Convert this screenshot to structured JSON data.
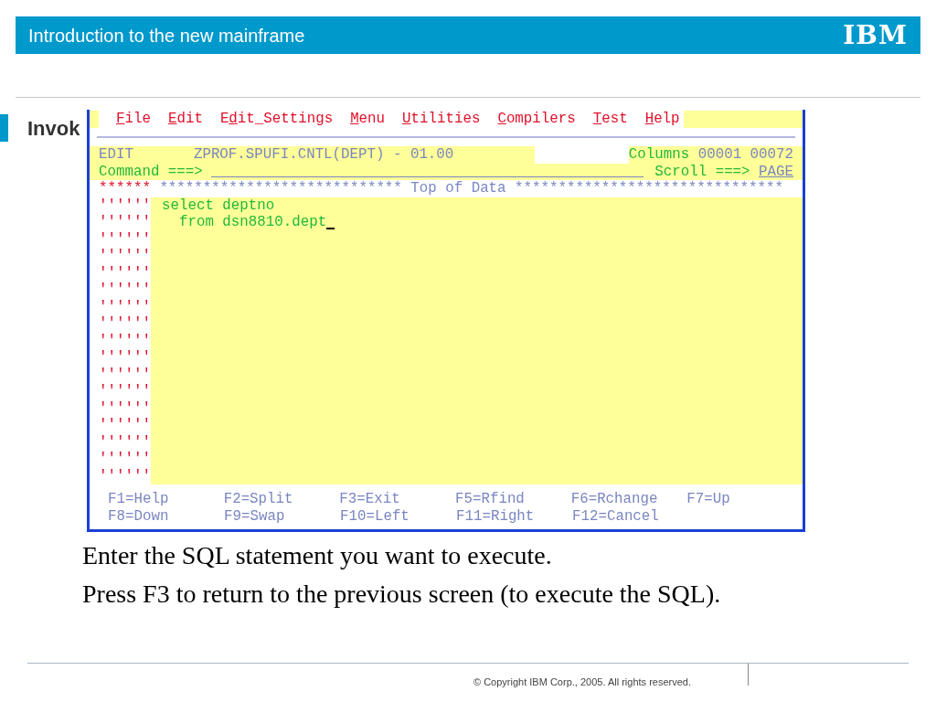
{
  "header": {
    "title": "Introduction to the new mainframe",
    "logo": "IBM"
  },
  "slide_title": "Invok",
  "terminal": {
    "menu": [
      {
        "key": "F",
        "after": "ile"
      },
      {
        "key": "E",
        "after": "dit"
      },
      {
        "before": "E",
        "key": "d",
        "after": "it_Settings"
      },
      {
        "key": "M",
        "after": "enu"
      },
      {
        "key": "U",
        "after": "tilities"
      },
      {
        "key": "C",
        "after": "ompilers"
      },
      {
        "key": "T",
        "after": "est"
      },
      {
        "key": "H",
        "after": "elp"
      }
    ],
    "edit_line": {
      "mode": "EDIT",
      "dataset": "ZPROF.SPUFI.CNTL(DEPT) - 01.00",
      "columns_label": "Columns",
      "columns_value": "00001 00072"
    },
    "command_line": {
      "label": "Command ===>",
      "scroll_label": "Scroll ===>",
      "scroll_value": "PAGE"
    },
    "top_of_data": {
      "prefix": "******",
      "text": "**************************** Top of Data *******************************"
    },
    "lines": [
      {
        "prefix": "''''''",
        "text": "select deptno",
        "cursor": false
      },
      {
        "prefix": "''''''",
        "text": "  from dsn8810.dept",
        "cursor": true
      },
      {
        "prefix": "''''''",
        "cursor": false
      },
      {
        "prefix": "''''''",
        "cursor": false
      },
      {
        "prefix": "''''''",
        "cursor": false
      },
      {
        "prefix": "''''''",
        "cursor": false
      },
      {
        "prefix": "''''''",
        "cursor": false
      },
      {
        "prefix": "''''''",
        "cursor": false
      },
      {
        "prefix": "''''''",
        "cursor": false
      },
      {
        "prefix": "''''''",
        "cursor": false
      },
      {
        "prefix": "''''''",
        "cursor": false
      },
      {
        "prefix": "''''''",
        "cursor": false
      },
      {
        "prefix": "''''''",
        "cursor": false
      },
      {
        "prefix": "''''''",
        "cursor": false
      },
      {
        "prefix": "''''''",
        "cursor": false
      },
      {
        "prefix": "''''''",
        "cursor": false
      },
      {
        "prefix": "''''''",
        "cursor": false
      }
    ],
    "function_keys": [
      [
        "F1=Help",
        "F2=Split",
        "F3=Exit",
        "F5=Rfind",
        "F6=Rchange",
        "F7=Up"
      ],
      [
        "F8=Down",
        "F9=Swap",
        "F10=Left",
        "F11=Right",
        "F12=Cancel"
      ]
    ]
  },
  "body": [
    "Enter the SQL statement you want to execute.",
    "Press F3 to return to the previous screen (to execute the SQL)."
  ],
  "footer": {
    "copyright": "© Copyright IBM Corp., 2005. All rights reserved."
  }
}
